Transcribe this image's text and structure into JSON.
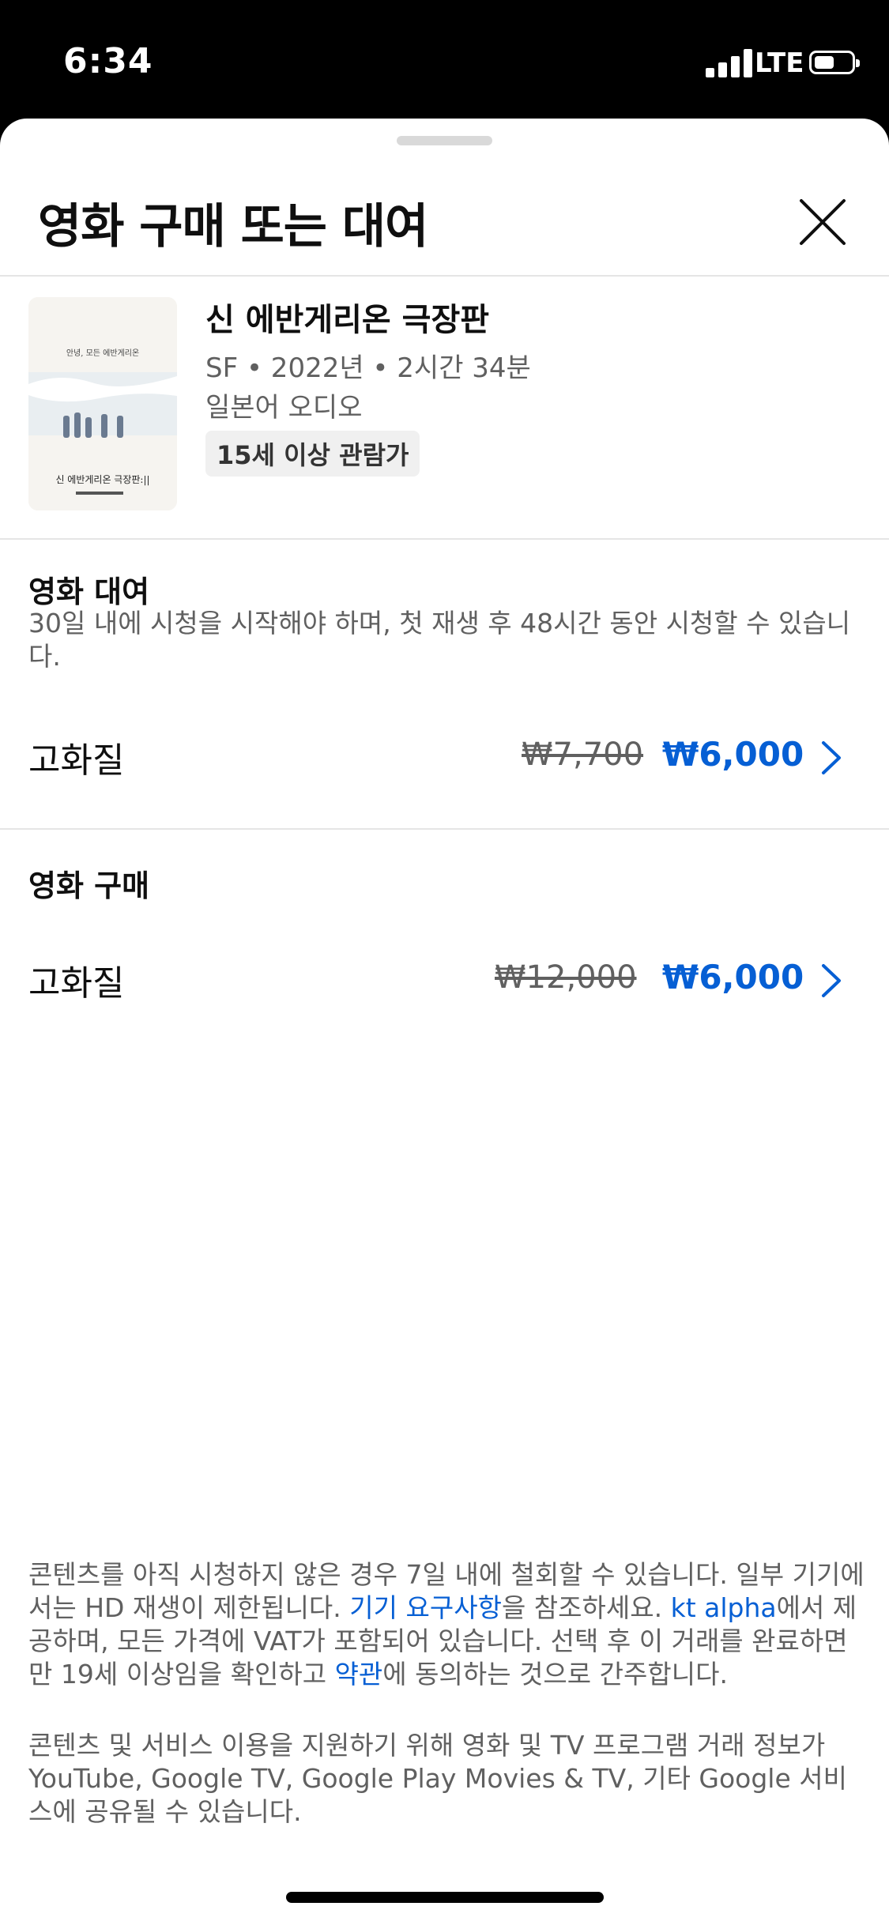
{
  "status_bar": {
    "time": "6:34",
    "network": "LTE",
    "battery_level": 0.55
  },
  "sheet": {
    "title": "영화 구매 또는 대여",
    "close_icon": "close-icon"
  },
  "movie": {
    "poster_tagline": "안녕, 모든 에반게리온",
    "poster_title": "신 에반게리온 극장판:||",
    "title": "신 에반게리온 극장판",
    "meta": "SF • 2022년 • 2시간 34분",
    "audio": "일본어 오디오",
    "rating": "15세 이상 관람가"
  },
  "rental": {
    "heading": "영화 대여",
    "description": "30일 내에 시청을 시작해야 하며, 첫 재생 후 48시간 동안 시청할 수 있습니다.",
    "option": {
      "quality": "고화질",
      "original_price": "₩7,700",
      "price": "₩6,000"
    }
  },
  "purchase": {
    "heading": "영화 구매",
    "option": {
      "quality": "고화질",
      "original_price": "₩12,000",
      "price": "₩6,000"
    }
  },
  "footer": {
    "p1_a": "콘텐츠를 아직 시청하지 않은 경우 7일 내에 철회할 수 있습니다. 일부 기기에서는 HD 재생이 제한됩니다. ",
    "p1_link1": "기기 요구사항",
    "p1_b": "을 참조하세요. ",
    "p1_link2": "kt alpha",
    "p1_c": "에서 제공하며, 모든 가격에 VAT가 포함되어 있습니다. 선택 후 이 거래를 완료하면 만 19세 이상임을 확인하고 ",
    "p1_link3": "약관",
    "p1_d": "에 동의하는 것으로 간주합니다.",
    "p2": "콘텐츠 및 서비스 이용을 지원하기 위해 영화 및 TV 프로그램 거래 정보가 YouTube, Google TV, Google Play Movies & TV, 기타 Google 서비스에 공유될 수 있습니다."
  },
  "colors": {
    "accent": "#065fd4",
    "secondary_text": "#606060",
    "divider": "#e5e5e5"
  }
}
